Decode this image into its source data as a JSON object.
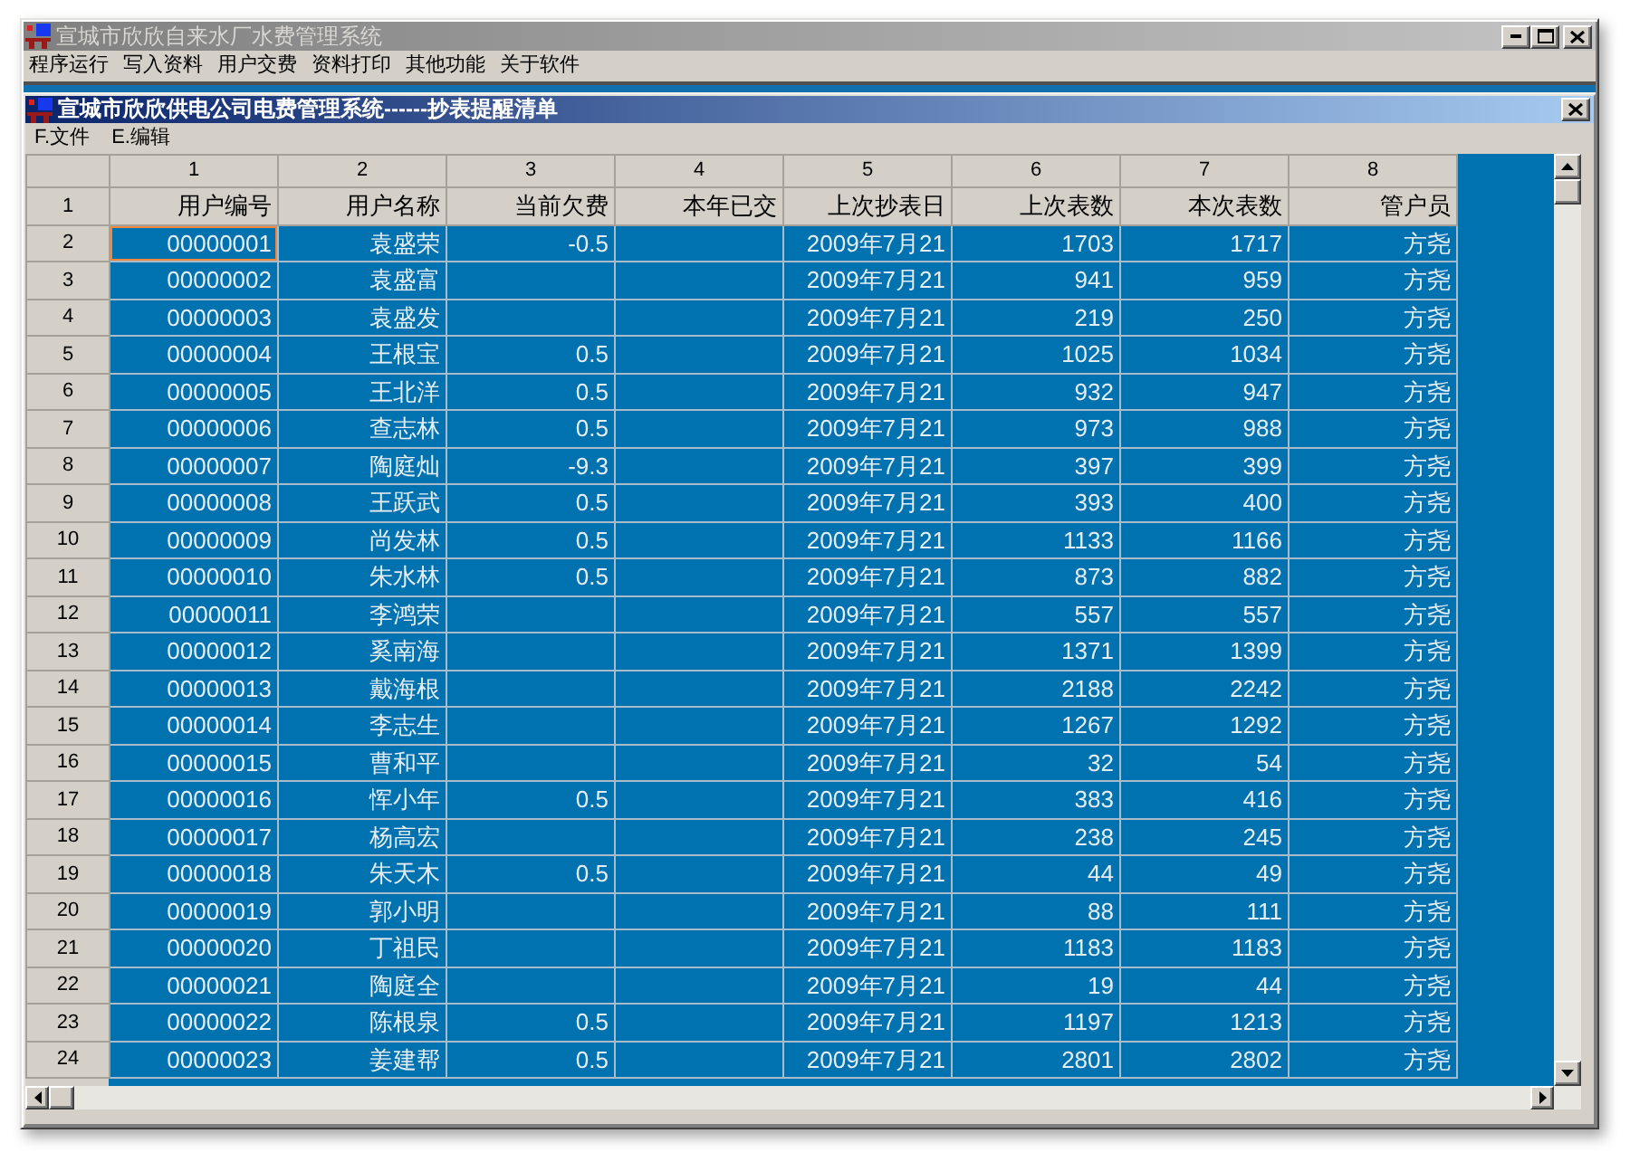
{
  "window": {
    "title": "宣城市欣欣自来水厂水费管理系统"
  },
  "menu": [
    "程序运行",
    "写入资料",
    "用户交费",
    "资料打印",
    "其他功能",
    "关于软件"
  ],
  "child_window": {
    "title": "宣城市欣欣供电公司电费管理系统------抄表提醒清单",
    "menu": [
      "F.文件",
      "E.编辑"
    ],
    "table": {
      "title_row_number": "1",
      "columns": [
        {
          "number": "1",
          "title": "用户编号"
        },
        {
          "number": "2",
          "title": "用户名称"
        },
        {
          "number": "3",
          "title": "当前欠费"
        },
        {
          "number": "4",
          "title": "本年已交"
        },
        {
          "number": "5",
          "title": "上次抄表日"
        },
        {
          "number": "6",
          "title": "上次表数"
        },
        {
          "number": "7",
          "title": "本次表数"
        },
        {
          "number": "8",
          "title": "管户员"
        }
      ],
      "rows": [
        {
          "row_number": "2",
          "current": true,
          "user_id": "00000001",
          "user_name": "袁盛荣",
          "arrears": "-0.5",
          "last_reading_date": "2009年7月21",
          "last_reading": "1703",
          "this_reading": "1717",
          "clerk": "方尧"
        },
        {
          "row_number": "3",
          "current": false,
          "user_id": "00000002",
          "user_name": "袁盛富",
          "last_reading_date": "2009年7月21",
          "last_reading": "941",
          "this_reading": "959",
          "clerk": "方尧"
        },
        {
          "row_number": "4",
          "current": false,
          "user_id": "00000003",
          "user_name": "袁盛发",
          "last_reading_date": "2009年7月21",
          "last_reading": "219",
          "this_reading": "250",
          "clerk": "方尧"
        },
        {
          "row_number": "5",
          "current": false,
          "user_id": "00000004",
          "user_name": "王根宝",
          "arrears": "0.5",
          "last_reading_date": "2009年7月21",
          "last_reading": "1025",
          "this_reading": "1034",
          "clerk": "方尧"
        },
        {
          "row_number": "6",
          "current": false,
          "user_id": "00000005",
          "user_name": "王北洋",
          "arrears": "0.5",
          "last_reading_date": "2009年7月21",
          "last_reading": "932",
          "this_reading": "947",
          "clerk": "方尧"
        },
        {
          "row_number": "7",
          "current": false,
          "user_id": "00000006",
          "user_name": "查志林",
          "arrears": "0.5",
          "last_reading_date": "2009年7月21",
          "last_reading": "973",
          "this_reading": "988",
          "clerk": "方尧"
        },
        {
          "row_number": "8",
          "current": false,
          "user_id": "00000007",
          "user_name": "陶庭灿",
          "arrears": "-9.3",
          "last_reading_date": "2009年7月21",
          "last_reading": "397",
          "this_reading": "399",
          "clerk": "方尧"
        },
        {
          "row_number": "9",
          "current": false,
          "user_id": "00000008",
          "user_name": "王跃武",
          "arrears": "0.5",
          "last_reading_date": "2009年7月21",
          "last_reading": "393",
          "this_reading": "400",
          "clerk": "方尧"
        },
        {
          "row_number": "10",
          "current": false,
          "user_id": "00000009",
          "user_name": "尚发林",
          "arrears": "0.5",
          "last_reading_date": "2009年7月21",
          "last_reading": "1133",
          "this_reading": "1166",
          "clerk": "方尧"
        },
        {
          "row_number": "11",
          "current": false,
          "user_id": "00000010",
          "user_name": "朱水林",
          "arrears": "0.5",
          "last_reading_date": "2009年7月21",
          "last_reading": "873",
          "this_reading": "882",
          "clerk": "方尧"
        },
        {
          "row_number": "12",
          "current": false,
          "user_id": "00000011",
          "user_name": "李鸿荣",
          "last_reading_date": "2009年7月21",
          "last_reading": "557",
          "this_reading": "557",
          "clerk": "方尧"
        },
        {
          "row_number": "13",
          "current": false,
          "user_id": "00000012",
          "user_name": "奚南海",
          "last_reading_date": "2009年7月21",
          "last_reading": "1371",
          "this_reading": "1399",
          "clerk": "方尧"
        },
        {
          "row_number": "14",
          "current": false,
          "user_id": "00000013",
          "user_name": "戴海根",
          "last_reading_date": "2009年7月21",
          "last_reading": "2188",
          "this_reading": "2242",
          "clerk": "方尧"
        },
        {
          "row_number": "15",
          "current": false,
          "user_id": "00000014",
          "user_name": "李志生",
          "last_reading_date": "2009年7月21",
          "last_reading": "1267",
          "this_reading": "1292",
          "clerk": "方尧"
        },
        {
          "row_number": "16",
          "current": false,
          "user_id": "00000015",
          "user_name": "曹和平",
          "last_reading_date": "2009年7月21",
          "last_reading": "32",
          "this_reading": "54",
          "clerk": "方尧"
        },
        {
          "row_number": "17",
          "current": false,
          "user_id": "00000016",
          "user_name": "恽小年",
          "arrears": "0.5",
          "last_reading_date": "2009年7月21",
          "last_reading": "383",
          "this_reading": "416",
          "clerk": "方尧"
        },
        {
          "row_number": "18",
          "current": false,
          "user_id": "00000017",
          "user_name": "杨高宏",
          "last_reading_date": "2009年7月21",
          "last_reading": "238",
          "this_reading": "245",
          "clerk": "方尧"
        },
        {
          "row_number": "19",
          "current": false,
          "user_id": "00000018",
          "user_name": "朱天木",
          "arrears": "0.5",
          "last_reading_date": "2009年7月21",
          "last_reading": "44",
          "this_reading": "49",
          "clerk": "方尧"
        },
        {
          "row_number": "20",
          "current": false,
          "user_id": "00000019",
          "user_name": "郭小明",
          "last_reading_date": "2009年7月21",
          "last_reading": "88",
          "this_reading": "111",
          "clerk": "方尧"
        },
        {
          "row_number": "21",
          "current": false,
          "user_id": "00000020",
          "user_name": "丁祖民",
          "last_reading_date": "2009年7月21",
          "last_reading": "1183",
          "this_reading": "1183",
          "clerk": "方尧"
        },
        {
          "row_number": "22",
          "current": false,
          "user_id": "00000021",
          "user_name": "陶庭全",
          "last_reading_date": "2009年7月21",
          "last_reading": "19",
          "this_reading": "44",
          "clerk": "方尧"
        },
        {
          "row_number": "23",
          "current": false,
          "user_id": "00000022",
          "user_name": "陈根泉",
          "arrears": "0.5",
          "last_reading_date": "2009年7月21",
          "last_reading": "1197",
          "this_reading": "1213",
          "clerk": "方尧"
        },
        {
          "row_number": "24",
          "current": false,
          "user_id": "00000023",
          "user_name": "姜建帮",
          "arrears": "0.5",
          "last_reading_date": "2009年7月21",
          "last_reading": "2801",
          "this_reading": "2802",
          "clerk": "方尧"
        }
      ]
    }
  }
}
